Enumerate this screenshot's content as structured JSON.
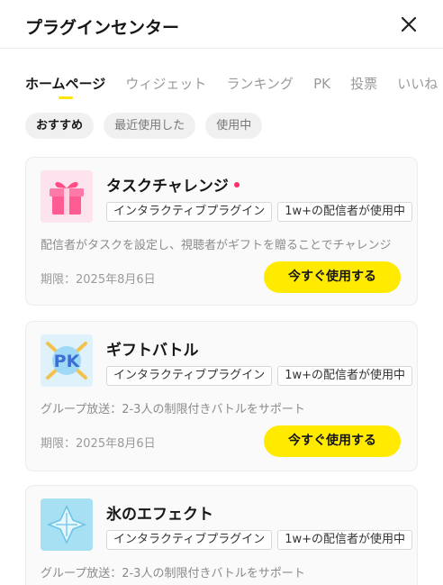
{
  "header": {
    "title": "プラグインセンター",
    "close_icon": "close-icon"
  },
  "tabs": [
    {
      "label": "ホームページ",
      "active": true
    },
    {
      "label": "ウィジェット"
    },
    {
      "label": "ランキング"
    },
    {
      "label": "PK"
    },
    {
      "label": "投票"
    },
    {
      "label": "いいね"
    }
  ],
  "filters": [
    {
      "label": "おすすめ",
      "active": true
    },
    {
      "label": "最近使用した"
    },
    {
      "label": "使用中"
    }
  ],
  "plugins": [
    {
      "name": "タスクチャレンジ",
      "is_new": true,
      "icon": "gift-box-icon",
      "tags": [
        "インタラクティブプラグイン",
        "1w+の配信者が使用中"
      ],
      "description": "配信者がタスクを設定し、視聴者がギフトを贈ることでチャレンジ",
      "deadline": "期限：2025年8月6日",
      "button": "今すぐ使用する"
    },
    {
      "name": "ギフトバトル",
      "icon": "pk-badge-icon",
      "tags": [
        "インタラクティブプラグイン",
        "1w+の配信者が使用中"
      ],
      "description": "グループ放送：2-3人の制限付きバトルをサポート",
      "deadline": "期限：2025年8月6日",
      "button": "今すぐ使用する"
    },
    {
      "name": "氷のエフェクト",
      "icon": "ice-crystal-icon",
      "tags": [
        "インタラクティブプラグイン",
        "1w+の配信者が使用中"
      ],
      "description": "グループ放送：2-3人の制限付きバトルをサポート"
    }
  ],
  "colors": {
    "accent": "#ffea00",
    "new_dot": "#ff2d6b",
    "chip_bg": "#f0f0f0"
  }
}
